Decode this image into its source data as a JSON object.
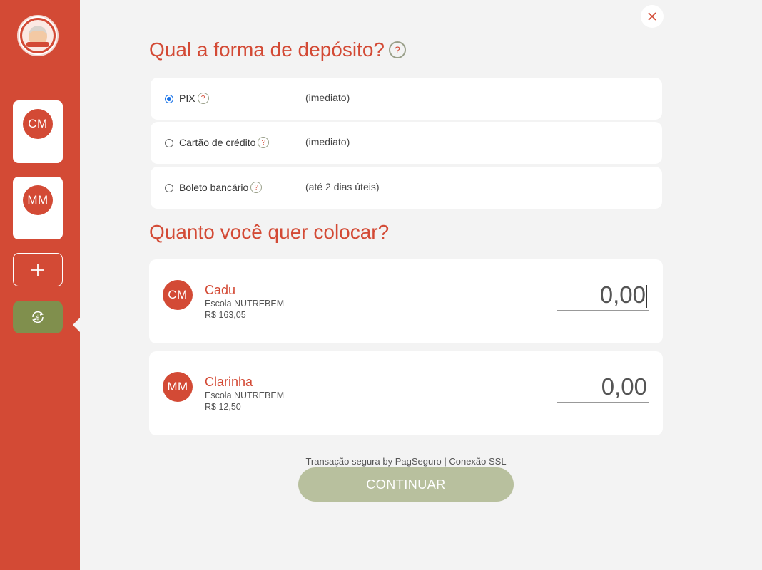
{
  "sidebar": {
    "kids": [
      {
        "initials": "CM"
      },
      {
        "initials": "MM"
      }
    ]
  },
  "deposit": {
    "title": "Qual a forma de depósito?",
    "help_glyph": "?",
    "options": [
      {
        "label": "PIX",
        "time": "(imediato)",
        "selected": true
      },
      {
        "label": "Cartão de crédito",
        "time": "(imediato)",
        "selected": false
      },
      {
        "label": "Boleto bancário",
        "time": "(até 2 dias úteis)",
        "selected": false
      }
    ]
  },
  "amounts": {
    "title": "Quanto você quer colocar?",
    "kids": [
      {
        "initials": "CM",
        "name": "Cadu",
        "school": "Escola NUTREBEM",
        "balance": "R$ 163,05",
        "amount": "0,00"
      },
      {
        "initials": "MM",
        "name": "Clarinha",
        "school": "Escola NUTREBEM",
        "balance": "R$ 12,50",
        "amount": "0,00"
      }
    ]
  },
  "footer": {
    "secure_text": "Transação segura by PagSeguro | Conexão SSL",
    "continue_label": "CONTINUAR"
  },
  "colors": {
    "brand_red": "#d34a35",
    "olive": "#808f4d",
    "continue_disabled": "#b8c09e",
    "radio_blue": "#1a73e8"
  }
}
